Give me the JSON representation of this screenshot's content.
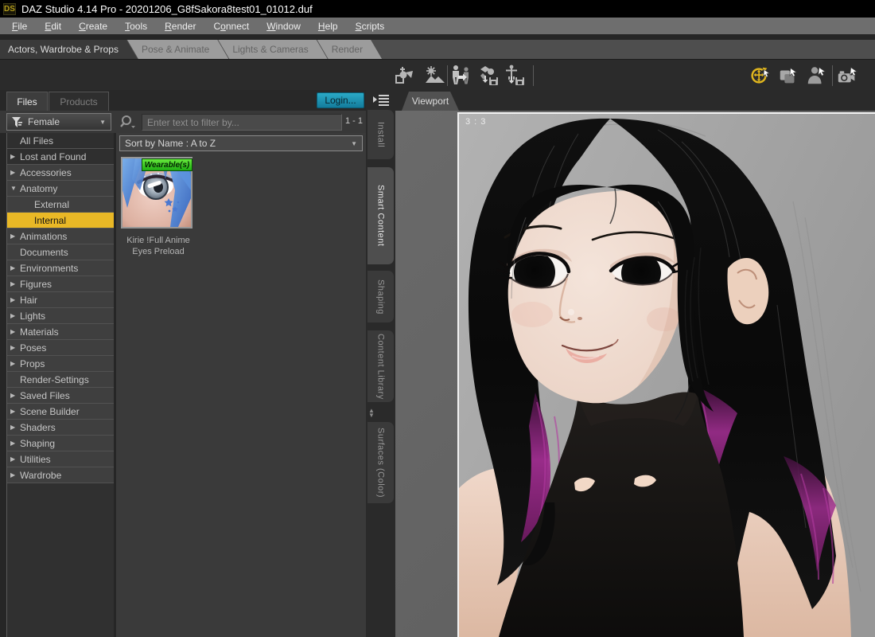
{
  "window": {
    "logo": "DS",
    "title": "DAZ Studio 4.14 Pro - 20201206_G8fSakora8test01_01012.duf"
  },
  "menubar": {
    "items": [
      {
        "label": "File",
        "u": 0
      },
      {
        "label": "Edit",
        "u": 0
      },
      {
        "label": "Create",
        "u": 0
      },
      {
        "label": "Tools",
        "u": 0
      },
      {
        "label": "Render",
        "u": 0
      },
      {
        "label": "Connect",
        "u": 1
      },
      {
        "label": "Window",
        "u": 0
      },
      {
        "label": "Help",
        "u": 0
      },
      {
        "label": "Scripts",
        "u": 0
      }
    ]
  },
  "activity_tabs": [
    {
      "label": "Actors, Wardrobe & Props",
      "active": true
    },
    {
      "label": "Pose & Animate",
      "active": false
    },
    {
      "label": "Lights & Cameras",
      "active": false
    },
    {
      "label": "Render",
      "active": false
    }
  ],
  "toolbar": {
    "left_icons": [
      "create-prop-icon",
      "create-environment-icon",
      "character-transfer-icon",
      "save-wearable-preset-icon",
      "save-pose-preset-icon"
    ],
    "right_icons": [
      "universal-manipulator-icon",
      "node-selection-icon",
      "figure-selection-icon",
      "camera-selection-icon"
    ],
    "active_tool_color": "#e2b71e"
  },
  "content_pane": {
    "tabs": [
      {
        "label": "Files",
        "active": true
      },
      {
        "label": "Products",
        "active": false
      }
    ],
    "login_button": "Login...",
    "filter_dropdown": "Female",
    "search": {
      "placeholder": "Enter text to filter by...",
      "count": "1 - 1"
    },
    "sort_dropdown": "Sort by Name : A to Z",
    "categories": [
      {
        "label": "All Files",
        "arrow": "none",
        "indent": 0,
        "selected": false,
        "dark": true
      },
      {
        "label": "Lost and Found",
        "arrow": "right",
        "indent": 0,
        "selected": false,
        "dark": true
      },
      {
        "label": "Accessories",
        "arrow": "right",
        "indent": 0,
        "selected": false,
        "dark": false
      },
      {
        "label": "Anatomy",
        "arrow": "down",
        "indent": 0,
        "selected": false,
        "dark": false
      },
      {
        "label": "External",
        "arrow": "none",
        "indent": 1,
        "selected": false,
        "dark": false
      },
      {
        "label": "Internal",
        "arrow": "none",
        "indent": 1,
        "selected": true,
        "dark": false
      },
      {
        "label": "Animations",
        "arrow": "right",
        "indent": 0,
        "selected": false,
        "dark": false
      },
      {
        "label": "Documents",
        "arrow": "none",
        "indent": 0,
        "selected": false,
        "dark": false
      },
      {
        "label": "Environments",
        "arrow": "right",
        "indent": 0,
        "selected": false,
        "dark": false
      },
      {
        "label": "Figures",
        "arrow": "right",
        "indent": 0,
        "selected": false,
        "dark": false
      },
      {
        "label": "Hair",
        "arrow": "right",
        "indent": 0,
        "selected": false,
        "dark": false
      },
      {
        "label": "Lights",
        "arrow": "right",
        "indent": 0,
        "selected": false,
        "dark": false
      },
      {
        "label": "Materials",
        "arrow": "right",
        "indent": 0,
        "selected": false,
        "dark": false
      },
      {
        "label": "Poses",
        "arrow": "right",
        "indent": 0,
        "selected": false,
        "dark": false
      },
      {
        "label": "Props",
        "arrow": "right",
        "indent": 0,
        "selected": false,
        "dark": false
      },
      {
        "label": "Render-Settings",
        "arrow": "none",
        "indent": 0,
        "selected": false,
        "dark": false
      },
      {
        "label": "Saved Files",
        "arrow": "right",
        "indent": 0,
        "selected": false,
        "dark": false
      },
      {
        "label": "Scene Builder",
        "arrow": "right",
        "indent": 0,
        "selected": false,
        "dark": false
      },
      {
        "label": "Shaders",
        "arrow": "right",
        "indent": 0,
        "selected": false,
        "dark": false
      },
      {
        "label": "Shaping",
        "arrow": "right",
        "indent": 0,
        "selected": false,
        "dark": false
      },
      {
        "label": "Utilities",
        "arrow": "right",
        "indent": 0,
        "selected": false,
        "dark": false
      },
      {
        "label": "Wardrobe",
        "arrow": "right",
        "indent": 0,
        "selected": false,
        "dark": false
      }
    ],
    "asset": {
      "badge": "Wearable(s)",
      "title": "Kirie !Full Anime Eyes Preload"
    }
  },
  "side_tabs": [
    {
      "label": "Install",
      "active": false
    },
    {
      "label": "Smart Content",
      "active": true
    },
    {
      "label": "Shaping",
      "active": false
    },
    {
      "label": "Content Library",
      "active": false
    },
    {
      "label": "Surfaces (Color)",
      "active": false
    }
  ],
  "viewport": {
    "tab": "Viewport",
    "ratio_label": "3 : 3"
  },
  "colors": {
    "selection_yellow": "#e9b826",
    "login_teal": "#1b93b4",
    "badge_green": "#2ec82e",
    "hair_purple": "#a02e90"
  }
}
